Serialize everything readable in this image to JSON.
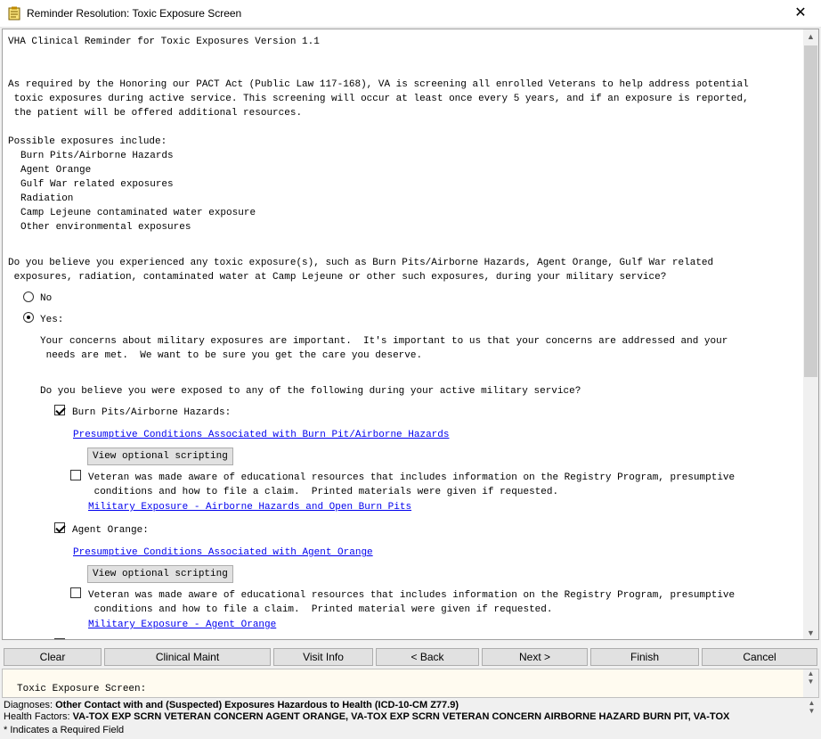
{
  "window": {
    "title": "Reminder Resolution: Toxic Exposure Screen",
    "close_glyph": "✕"
  },
  "content": {
    "heading": "VHA Clinical Reminder for Toxic Exposures Version 1.1",
    "intro": [
      "As required by the Honoring our PACT Act (Public Law 117-168), VA is screening all enrolled Veterans to help address potential",
      " toxic exposures during active service. This screening will occur at least once every 5 years, and if an exposure is reported,",
      " the patient will be offered additional resources."
    ],
    "possible_label": "Possible exposures include:",
    "possible": [
      "Burn Pits/Airborne Hazards",
      "Agent Orange",
      "Gulf War related exposures",
      "Radiation",
      "Camp Lejeune contaminated water exposure",
      "Other environmental exposures"
    ],
    "question": [
      "Do you believe you experienced any toxic exposure(s), such as Burn Pits/Airborne Hazards, Agent Orange, Gulf War related",
      " exposures, radiation, contaminated water at Camp Lejeune or other such exposures, during your military service?"
    ],
    "no_label": "No",
    "yes_label": "Yes:",
    "yes_text": [
      "Your concerns about military exposures are important.  It's important to us that your concerns are addressed and your",
      " needs are met.  We want to be sure you get the care you deserve."
    ],
    "exposed_question": "Do you believe you were exposed to any of the following during your active military service?",
    "burn": {
      "label": "Burn Pits/Airborne Hazards:",
      "link": "Presumptive Conditions Associated with Burn Pit/Airborne Hazards",
      "button": "View optional scripting",
      "edu": [
        "Veteran was made aware of educational resources that includes information on the Registry Program, presumptive",
        " conditions and how to file a claim.  Printed materials were given if requested."
      ],
      "edu_link": "Military Exposure - Airborne Hazards and Open Burn Pits"
    },
    "agent": {
      "label": "Agent Orange:",
      "link": "Presumptive Conditions Associated with Agent Orange",
      "button": "View optional scripting",
      "edu": [
        "Veteran was made aware of educational resources that includes information on the Registry Program, presumptive",
        " conditions and how to file a claim.  Printed material were given if requested."
      ],
      "edu_link": "Military Exposure - Agent Orange"
    }
  },
  "buttons": {
    "clear": "Clear",
    "clinical_maint": "Clinical Maint",
    "visit_info": "Visit Info",
    "back": "< Back",
    "next": "Next >",
    "finish": "Finish",
    "cancel": "Cancel"
  },
  "summary": {
    "text": "Toxic Exposure Screen:"
  },
  "footer": {
    "diagnoses_label": "Diagnoses:",
    "diagnoses_value": "Other Contact with and (Suspected) Exposures Hazardous to Health (ICD-10-CM Z77.9)",
    "health_label": "Health Factors:",
    "health_value": "VA-TOX EXP SCRN VETERAN CONCERN AGENT ORANGE, VA-TOX EXP SCRN VETERAN CONCERN AIRBORNE HAZARD BURN PIT, VA-TOX",
    "required": "* Indicates a Required Field"
  }
}
